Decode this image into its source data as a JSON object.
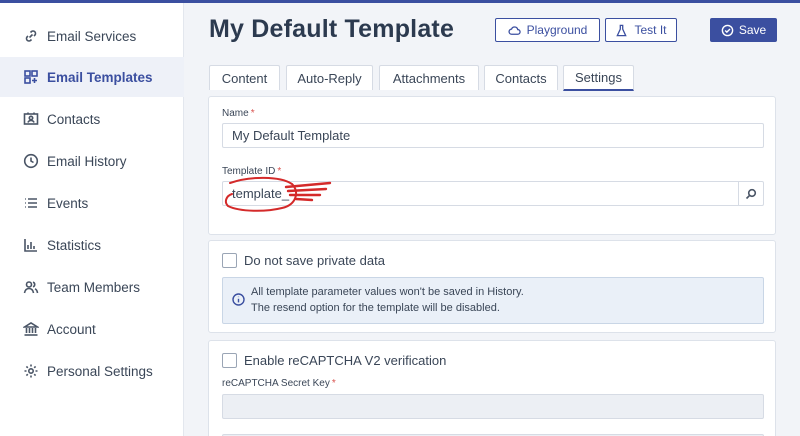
{
  "sidebar": {
    "items": [
      {
        "label": "Email Services",
        "icon": "link-icon"
      },
      {
        "label": "Email Templates",
        "icon": "templates-icon",
        "active": true
      },
      {
        "label": "Contacts",
        "icon": "contact-card-icon"
      },
      {
        "label": "Email History",
        "icon": "clock-icon"
      },
      {
        "label": "Events",
        "icon": "list-icon"
      },
      {
        "label": "Statistics",
        "icon": "bar-chart-icon"
      },
      {
        "label": "Team Members",
        "icon": "users-icon"
      },
      {
        "label": "Account",
        "icon": "bank-icon"
      },
      {
        "label": "Personal Settings",
        "icon": "gear-icon"
      }
    ]
  },
  "header": {
    "title": "My Default Template",
    "playground_label": "Playground",
    "test_label": "Test It",
    "save_label": "Save"
  },
  "tabs": [
    {
      "label": "Content"
    },
    {
      "label": "Auto-Reply"
    },
    {
      "label": "Attachments"
    },
    {
      "label": "Contacts"
    },
    {
      "label": "Settings",
      "active": true
    }
  ],
  "settings": {
    "name_label": "Name",
    "name_value": "My Default Template",
    "template_id_label": "Template ID",
    "template_id_value": "template_",
    "required_mark": "*",
    "private_data_label": "Do not save private data",
    "private_data_checked": false,
    "info_line1": "All template parameter values won't be saved in History.",
    "info_line2": "The resend option for the template will be disabled.",
    "recaptcha_label": "Enable reCAPTCHA V2 verification",
    "recaptcha_checked": false,
    "recaptcha_key_label": "reCAPTCHA Secret Key",
    "recaptcha_key_value": ""
  },
  "colors": {
    "accent": "#3b4fa0",
    "required": "#d9534f",
    "scribble": "#d42a2a"
  }
}
